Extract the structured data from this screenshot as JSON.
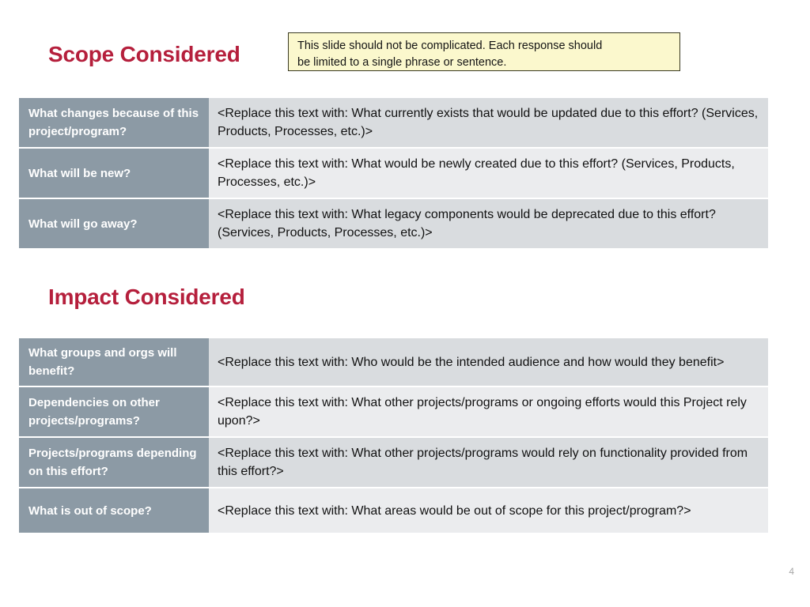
{
  "slide": {
    "page_number": "4",
    "accent_color": "#b51f3c",
    "header_cell_color": "#8c9aa5",
    "note_fill_color": "#fbf8cd",
    "note_border_color": "#3a3a22",
    "band_dark_color": "#d9dcdf",
    "band_light_color": "#ebecee"
  },
  "note": {
    "line1": "This slide should not be complicated. Each response should",
    "line2": "be limited to a single phrase or sentence."
  },
  "scope": {
    "title": "Scope Considered",
    "rows": [
      {
        "question": "What changes because of this project/program?",
        "answer": "<Replace this text with: What currently exists that would be updated due to this effort? (Services, Products, Processes, etc.)>"
      },
      {
        "question": "What will be new?",
        "answer": "<Replace this text with: What would be newly created due to this effort? (Services, Products, Processes, etc.)>"
      },
      {
        "question": "What will go away?",
        "answer": "<Replace this text with: What legacy components would be deprecated due to this effort? (Services, Products, Processes, etc.)>"
      }
    ]
  },
  "impact": {
    "title": "Impact Considered",
    "rows": [
      {
        "question": "What groups and orgs will benefit?",
        "answer": "<Replace this text with: Who would be the intended audience and how would they benefit>"
      },
      {
        "question": "Dependencies on other projects/programs?",
        "answer": "<Replace this text with: What other projects/programs or ongoing efforts would this Project rely upon?>"
      },
      {
        "question": "Projects/programs depending on this effort?",
        "answer": "<Replace this text with: What other projects/programs would rely on functionality provided from this effort?>"
      },
      {
        "question": "What is out of scope?",
        "answer": "<Replace this text with: What areas would be out of scope for this project/program?>"
      }
    ]
  }
}
